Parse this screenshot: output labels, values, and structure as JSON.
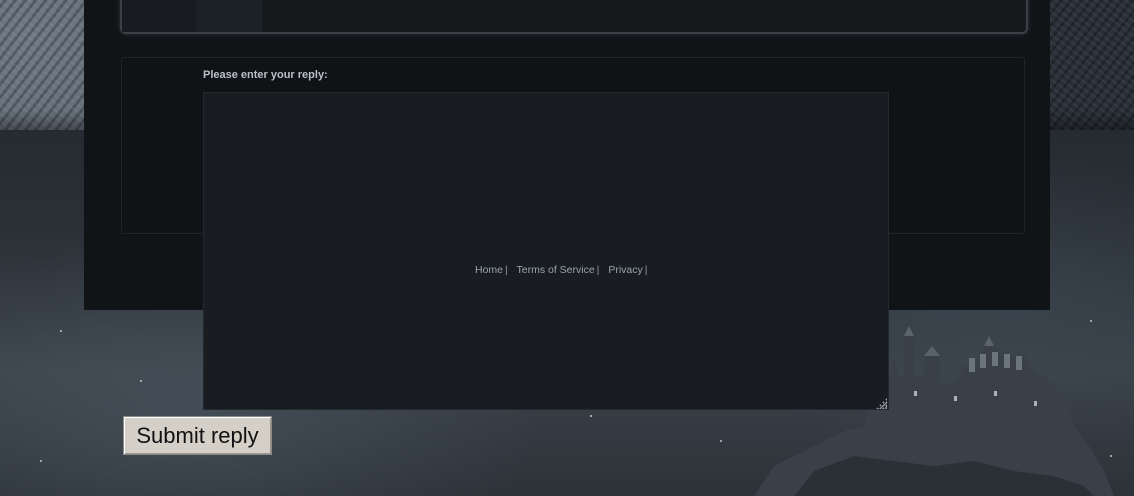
{
  "reply": {
    "label": "Please enter your reply:",
    "value": ""
  },
  "footer": {
    "links": [
      {
        "label": "Home",
        "separator": "|"
      },
      {
        "label": "Terms of Service",
        "separator": "|"
      },
      {
        "label": "Privacy",
        "separator": "|"
      }
    ]
  },
  "submit": {
    "label": "Submit reply"
  },
  "colors": {
    "panel": "#111417",
    "textarea": "#191d21",
    "button": "#d4d0c8"
  }
}
